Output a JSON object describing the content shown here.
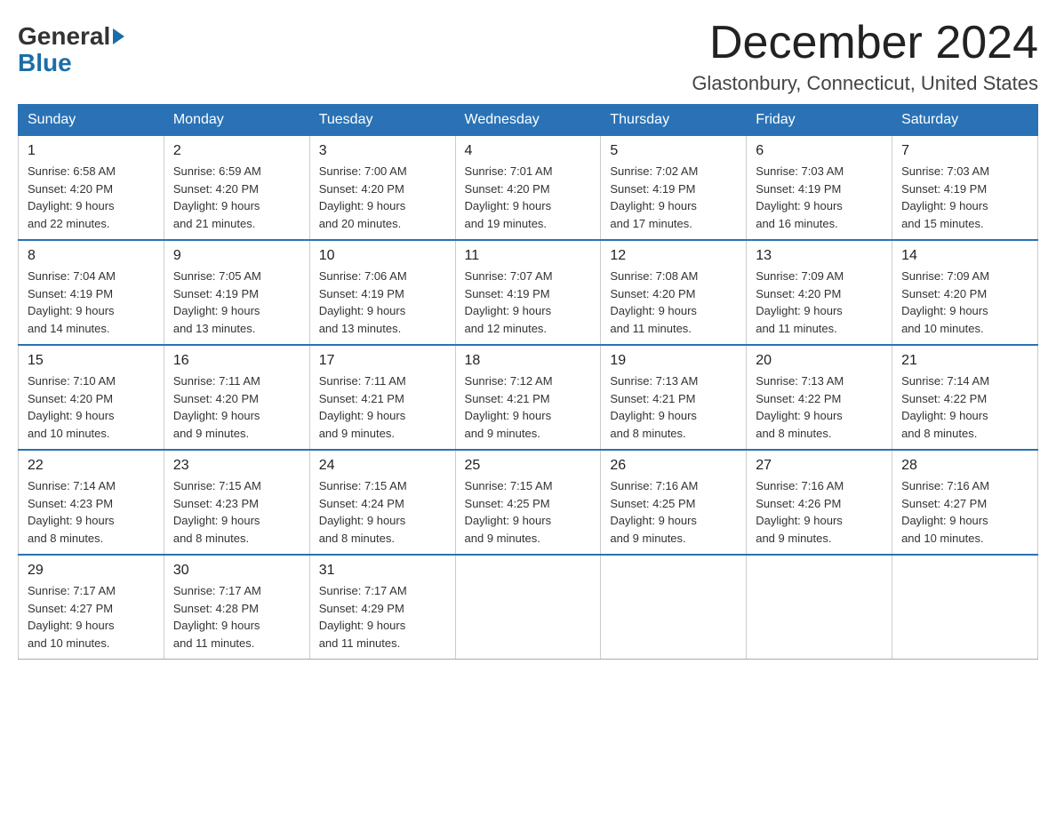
{
  "logo": {
    "general": "General",
    "blue": "Blue"
  },
  "title": "December 2024",
  "location": "Glastonbury, Connecticut, United States",
  "weekdays": [
    "Sunday",
    "Monday",
    "Tuesday",
    "Wednesday",
    "Thursday",
    "Friday",
    "Saturday"
  ],
  "weeks": [
    [
      {
        "day": "1",
        "sunrise": "6:58 AM",
        "sunset": "4:20 PM",
        "daylight": "9 hours and 22 minutes."
      },
      {
        "day": "2",
        "sunrise": "6:59 AM",
        "sunset": "4:20 PM",
        "daylight": "9 hours and 21 minutes."
      },
      {
        "day": "3",
        "sunrise": "7:00 AM",
        "sunset": "4:20 PM",
        "daylight": "9 hours and 20 minutes."
      },
      {
        "day": "4",
        "sunrise": "7:01 AM",
        "sunset": "4:20 PM",
        "daylight": "9 hours and 19 minutes."
      },
      {
        "day": "5",
        "sunrise": "7:02 AM",
        "sunset": "4:19 PM",
        "daylight": "9 hours and 17 minutes."
      },
      {
        "day": "6",
        "sunrise": "7:03 AM",
        "sunset": "4:19 PM",
        "daylight": "9 hours and 16 minutes."
      },
      {
        "day": "7",
        "sunrise": "7:03 AM",
        "sunset": "4:19 PM",
        "daylight": "9 hours and 15 minutes."
      }
    ],
    [
      {
        "day": "8",
        "sunrise": "7:04 AM",
        "sunset": "4:19 PM",
        "daylight": "9 hours and 14 minutes."
      },
      {
        "day": "9",
        "sunrise": "7:05 AM",
        "sunset": "4:19 PM",
        "daylight": "9 hours and 13 minutes."
      },
      {
        "day": "10",
        "sunrise": "7:06 AM",
        "sunset": "4:19 PM",
        "daylight": "9 hours and 13 minutes."
      },
      {
        "day": "11",
        "sunrise": "7:07 AM",
        "sunset": "4:19 PM",
        "daylight": "9 hours and 12 minutes."
      },
      {
        "day": "12",
        "sunrise": "7:08 AM",
        "sunset": "4:20 PM",
        "daylight": "9 hours and 11 minutes."
      },
      {
        "day": "13",
        "sunrise": "7:09 AM",
        "sunset": "4:20 PM",
        "daylight": "9 hours and 11 minutes."
      },
      {
        "day": "14",
        "sunrise": "7:09 AM",
        "sunset": "4:20 PM",
        "daylight": "9 hours and 10 minutes."
      }
    ],
    [
      {
        "day": "15",
        "sunrise": "7:10 AM",
        "sunset": "4:20 PM",
        "daylight": "9 hours and 10 minutes."
      },
      {
        "day": "16",
        "sunrise": "7:11 AM",
        "sunset": "4:20 PM",
        "daylight": "9 hours and 9 minutes."
      },
      {
        "day": "17",
        "sunrise": "7:11 AM",
        "sunset": "4:21 PM",
        "daylight": "9 hours and 9 minutes."
      },
      {
        "day": "18",
        "sunrise": "7:12 AM",
        "sunset": "4:21 PM",
        "daylight": "9 hours and 9 minutes."
      },
      {
        "day": "19",
        "sunrise": "7:13 AM",
        "sunset": "4:21 PM",
        "daylight": "9 hours and 8 minutes."
      },
      {
        "day": "20",
        "sunrise": "7:13 AM",
        "sunset": "4:22 PM",
        "daylight": "9 hours and 8 minutes."
      },
      {
        "day": "21",
        "sunrise": "7:14 AM",
        "sunset": "4:22 PM",
        "daylight": "9 hours and 8 minutes."
      }
    ],
    [
      {
        "day": "22",
        "sunrise": "7:14 AM",
        "sunset": "4:23 PM",
        "daylight": "9 hours and 8 minutes."
      },
      {
        "day": "23",
        "sunrise": "7:15 AM",
        "sunset": "4:23 PM",
        "daylight": "9 hours and 8 minutes."
      },
      {
        "day": "24",
        "sunrise": "7:15 AM",
        "sunset": "4:24 PM",
        "daylight": "9 hours and 8 minutes."
      },
      {
        "day": "25",
        "sunrise": "7:15 AM",
        "sunset": "4:25 PM",
        "daylight": "9 hours and 9 minutes."
      },
      {
        "day": "26",
        "sunrise": "7:16 AM",
        "sunset": "4:25 PM",
        "daylight": "9 hours and 9 minutes."
      },
      {
        "day": "27",
        "sunrise": "7:16 AM",
        "sunset": "4:26 PM",
        "daylight": "9 hours and 9 minutes."
      },
      {
        "day": "28",
        "sunrise": "7:16 AM",
        "sunset": "4:27 PM",
        "daylight": "9 hours and 10 minutes."
      }
    ],
    [
      {
        "day": "29",
        "sunrise": "7:17 AM",
        "sunset": "4:27 PM",
        "daylight": "9 hours and 10 minutes."
      },
      {
        "day": "30",
        "sunrise": "7:17 AM",
        "sunset": "4:28 PM",
        "daylight": "9 hours and 11 minutes."
      },
      {
        "day": "31",
        "sunrise": "7:17 AM",
        "sunset": "4:29 PM",
        "daylight": "9 hours and 11 minutes."
      },
      null,
      null,
      null,
      null
    ]
  ]
}
